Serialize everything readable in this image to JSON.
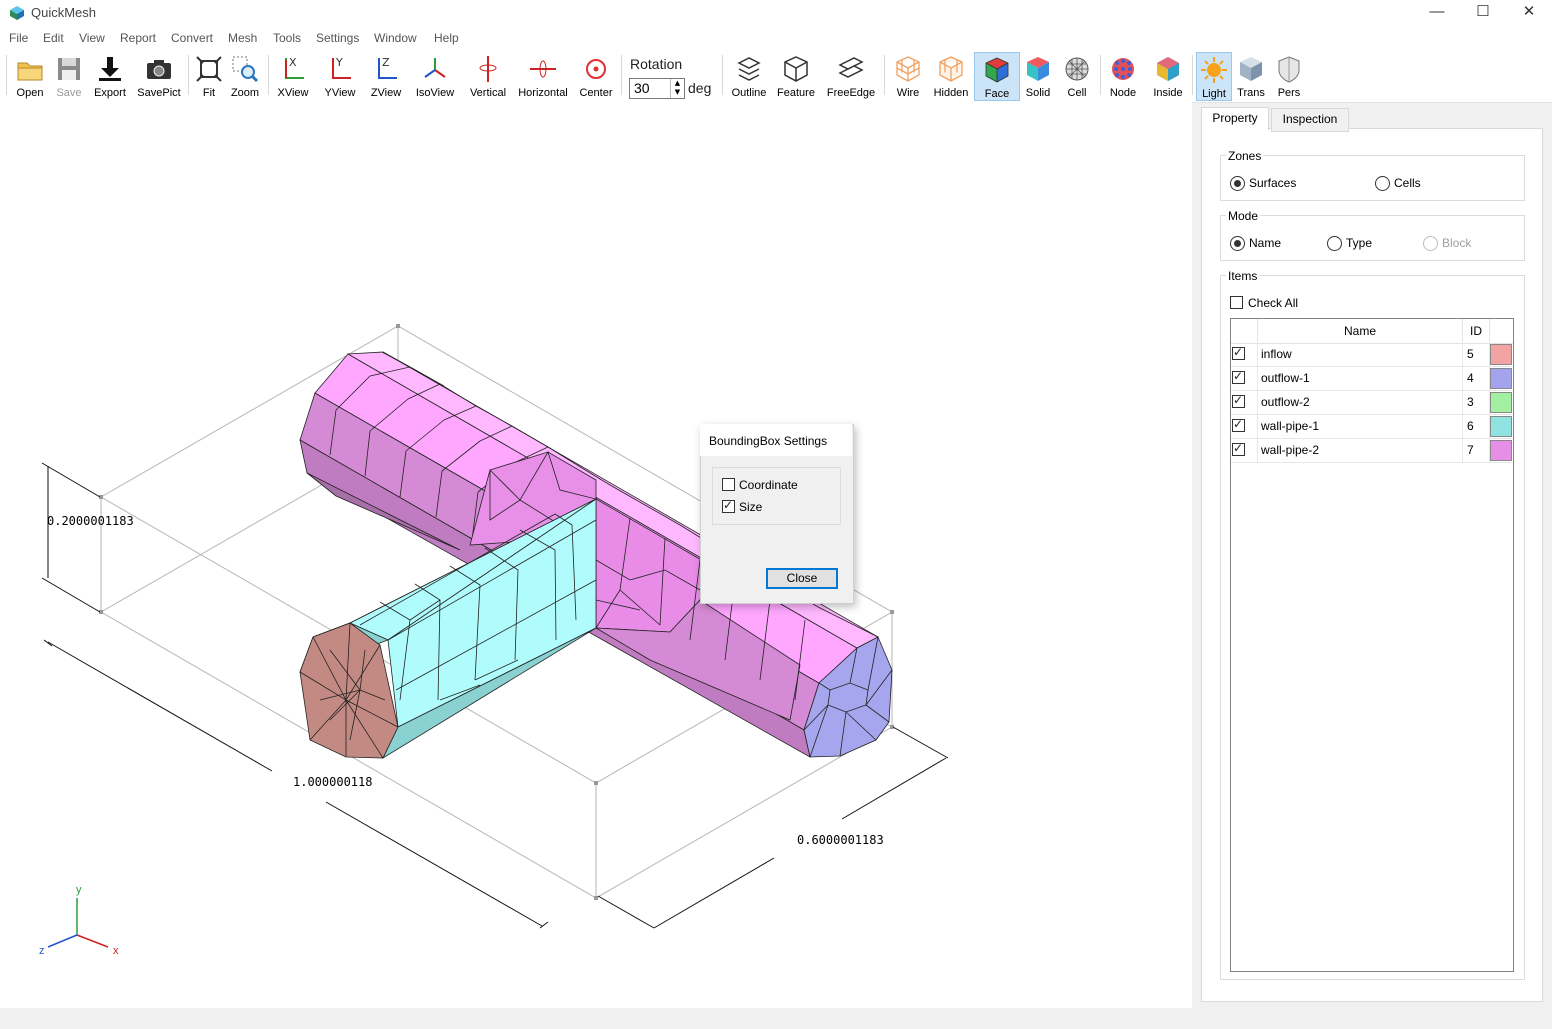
{
  "window": {
    "title": "QuickMesh",
    "controls": {
      "minimize": "—",
      "maximize": "☐",
      "close": "✕"
    }
  },
  "menu": [
    "File",
    "Edit",
    "View",
    "Report",
    "Convert",
    "Mesh",
    "Tools",
    "Settings",
    "Window",
    "Help"
  ],
  "toolbar": {
    "open": "Open",
    "save": "Save",
    "export": "Export",
    "savepict": "SavePict",
    "fit": "Fit",
    "zoom": "Zoom",
    "xview": "XView",
    "yview": "YView",
    "zview": "ZView",
    "isoview": "IsoView",
    "vertical": "Vertical",
    "horizontal": "Horizontal",
    "center": "Center",
    "rotation_label": "Rotation",
    "rotation_value": "30",
    "rotation_unit": "deg",
    "outline": "Outline",
    "feature": "Feature",
    "freeedge": "FreeEdge",
    "wire": "Wire",
    "hidden": "Hidden",
    "face": "Face",
    "solid": "Solid",
    "cell": "Cell",
    "node": "Node",
    "inside": "Inside",
    "light": "Light",
    "trans": "Trans",
    "pers": "Pers"
  },
  "viewport": {
    "dim_height": "0.2000001183",
    "dim_length": "1.000000118",
    "dim_depth": "0.6000001183",
    "axis_y": "y",
    "axis_x": "x",
    "axis_z": "z"
  },
  "dialog": {
    "title": "BoundingBox Settings",
    "coordinate_label": "Coordinate",
    "coordinate_checked": false,
    "size_label": "Size",
    "size_checked": true,
    "close_label": "Close"
  },
  "panel": {
    "tabs": [
      "Property",
      "Inspection"
    ],
    "zones": {
      "title": "Zones",
      "surfaces": "Surfaces",
      "cells": "Cells",
      "selected": "Surfaces"
    },
    "mode": {
      "title": "Mode",
      "name": "Name",
      "type": "Type",
      "block": "Block",
      "selected": "Name"
    },
    "items": {
      "title": "Items",
      "check_all": "Check All",
      "col_name": "Name",
      "col_id": "ID",
      "rows": [
        {
          "name": "inflow",
          "id": "5",
          "color": "#f4a3a3",
          "checked": true
        },
        {
          "name": "outflow-1",
          "id": "4",
          "color": "#a3a3ee",
          "checked": true
        },
        {
          "name": "outflow-2",
          "id": "3",
          "color": "#a3f0a3",
          "checked": true
        },
        {
          "name": "wall-pipe-1",
          "id": "6",
          "color": "#8fe3e0",
          "checked": true
        },
        {
          "name": "wall-pipe-2",
          "id": "7",
          "color": "#e58fe6",
          "checked": true
        }
      ]
    }
  },
  "colors": {
    "pipe2_top": "#ffa6ff",
    "pipe2_side": "#d48ad4",
    "pipe1_top": "#b0fcfc",
    "pipe1_side": "#8ad2d2",
    "inflow_face": "#c28a82",
    "outflow_face": "#a6a6ee",
    "accent": "#0078d7"
  }
}
